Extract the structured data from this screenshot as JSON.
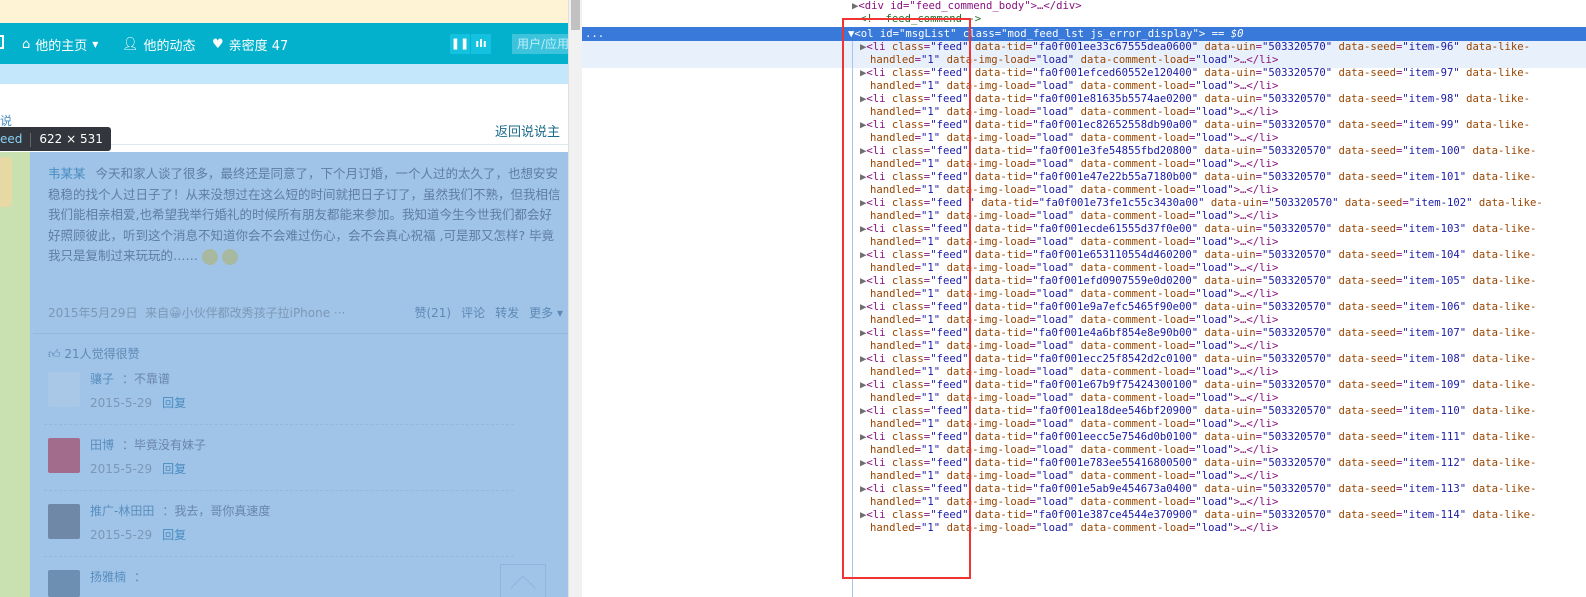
{
  "page": {
    "nav": {
      "home": "他的主页",
      "feed": "他的动态",
      "intimacy": "亲密度 47",
      "search_placeholder": "用户/应用"
    },
    "partial_title": "说",
    "back_link": "返回说说主",
    "inspector_tooltip": {
      "selector": "eed",
      "size": "622 × 531"
    },
    "post": {
      "author": "韦某某",
      "text": "今天和家人谈了很多，最终还是同意了，下个月订婚，一个人过的太久了，也想安安稳稳的找个人过日子了！从来没想过在这么短的时间就把日子订了，虽然我们不熟，但我相信我们能相亲相爱,也希望我举行婚礼的时候所有朋友都能来参加。我知道今生今世我们都会好好照顾彼此，听到这个消息不知道你会不会难过伤心，会不会真心祝福 ,可是那又怎样? 毕竟我只是复制过来玩玩的……",
      "date": "2015年5月29日",
      "source": "来自😀小伙伴都改秀孩子拉iPhone ···",
      "actions": {
        "like": "赞(21)",
        "comment": "评论",
        "forward": "转发",
        "more": "更多 ▾"
      },
      "likes_text": "21人觉得很赞",
      "comments": [
        {
          "user": "骧子",
          "text": "：不靠谱",
          "date": "2015-5-29",
          "reply": "回复",
          "avatar_color": "#a9c7e6"
        },
        {
          "user": "田博",
          "text": "：毕竟没有妹子",
          "date": "2015-5-29",
          "reply": "回复",
          "avatar_color": "#a26d8d"
        },
        {
          "user": "推广-林田田",
          "text": "：我去，哥你真速度",
          "date": "2015-5-29",
          "reply": "回复",
          "avatar_color": "#6f88a8"
        },
        {
          "user": "扬雅楠",
          "text": "：",
          "date": "",
          "reply": "",
          "avatar_color": "#6d8fb2"
        }
      ]
    }
  },
  "devtools": {
    "line_body": "<div id=\"feed_commend_body\">…</div>",
    "line_comment": "<!--feed_commend-->",
    "selected": {
      "tag": "<ol ",
      "id_attr": "id=",
      "id_val": "\"msgList\"",
      "class_attr": " class=",
      "class_val": "\"mod_feed_lst js_error_display\"",
      "tail": ">",
      "eq": " == $0"
    },
    "ellipsis": "...",
    "uin": "503320570",
    "items": [
      {
        "tid": "fa0f001ee33c67555dea0600",
        "seed": "item-96"
      },
      {
        "tid": "fa0f001efced60552e120400",
        "seed": "item-97"
      },
      {
        "tid": "fa0f001e81635b5574ae0200",
        "seed": "item-98"
      },
      {
        "tid": "fa0f001ec82652558db90a00",
        "seed": "item-99"
      },
      {
        "tid": "fa0f001e3fe54855fbd20800",
        "seed": "item-100"
      },
      {
        "tid": "fa0f001e47e22b55a7180b00",
        "seed": "item-101"
      },
      {
        "tid": "fa0f001e73fe1c55c3430a00",
        "seed": "item-102",
        "cls": "feed "
      },
      {
        "tid": "fa0f001ecde61555d37f0e00",
        "seed": "item-103"
      },
      {
        "tid": "fa0f001e653110554d460200",
        "seed": "item-104"
      },
      {
        "tid": "fa0f001efd0907559e0d0200",
        "seed": "item-105"
      },
      {
        "tid": "fa0f001e9a7efc5465f90e00",
        "seed": "item-106"
      },
      {
        "tid": "fa0f001e4a6bf854e8e90b00",
        "seed": "item-107"
      },
      {
        "tid": "fa0f001ecc25f8542d2c0100",
        "seed": "item-108"
      },
      {
        "tid": "fa0f001e67b9f75424300100",
        "seed": "item-109"
      },
      {
        "tid": "fa0f001ea18dee546bf20900",
        "seed": "item-110"
      },
      {
        "tid": "fa0f001eecc5e7546d0b0100",
        "seed": "item-111"
      },
      {
        "tid": "fa0f001e783ee55416800500",
        "seed": "item-112"
      },
      {
        "tid": "fa0f001e5ab9e454673a0400",
        "seed": "item-113"
      },
      {
        "tid": "fa0f001e387ce4544e370900",
        "seed": "item-114"
      }
    ]
  },
  "colors": {
    "nav": "#04b1cc",
    "highlight_overlay": "#9fc4e8",
    "selected_node": "#3879d9",
    "annotation_box": "#f03434"
  }
}
